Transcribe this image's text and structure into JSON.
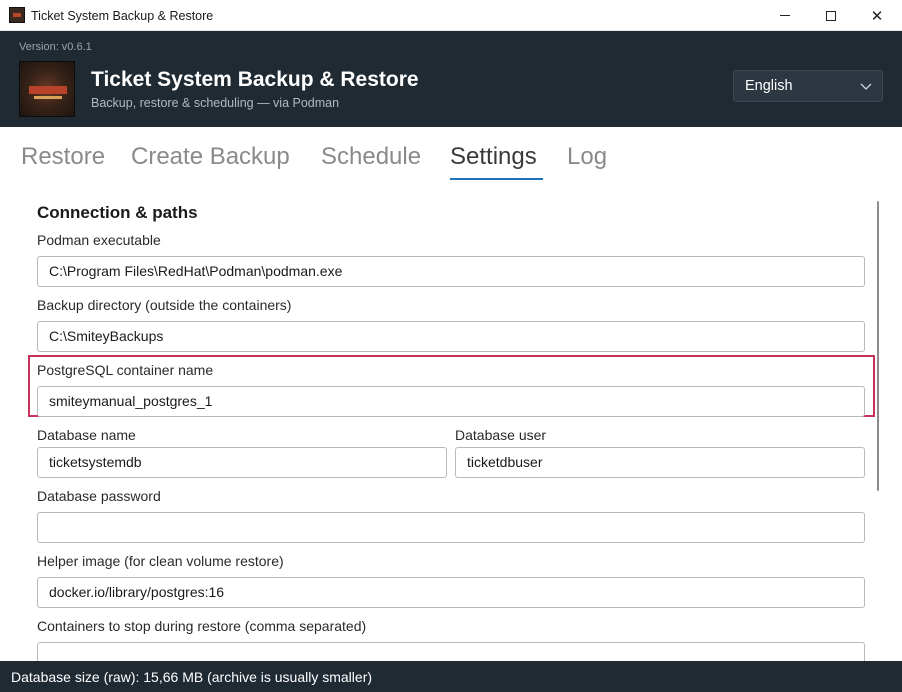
{
  "window": {
    "title": "Ticket System Backup & Restore",
    "minimize_glyph": "",
    "maximize_glyph": "",
    "close_glyph": "✕"
  },
  "header": {
    "version": "Version: v0.6.1",
    "title": "Ticket System Backup & Restore",
    "subtitle": "Backup, restore & scheduling — via Podman",
    "language": "English"
  },
  "tabs": [
    {
      "label": "Restore",
      "active": false
    },
    {
      "label": "Create Backup",
      "active": false
    },
    {
      "label": "Schedule",
      "active": false
    },
    {
      "label": "Settings",
      "active": true
    },
    {
      "label": "Log",
      "active": false
    }
  ],
  "settings": {
    "section_title": "Connection & paths",
    "podman_exe": {
      "label": "Podman executable",
      "value": "C:\\Program Files\\RedHat\\Podman\\podman.exe"
    },
    "backup_dir": {
      "label": "Backup directory (outside the containers)",
      "value": "C:\\SmiteyBackups"
    },
    "pg_container": {
      "label": "PostgreSQL container name",
      "value": "smiteymanual_postgres_1"
    },
    "db_name": {
      "label": "Database name",
      "value": "ticketsystemdb"
    },
    "db_user": {
      "label": "Database user",
      "value": "ticketdbuser"
    },
    "db_password": {
      "label": "Database password",
      "value": ""
    },
    "helper_image": {
      "label": "Helper image (for clean volume restore)",
      "value": "docker.io/library/postgres:16"
    },
    "containers_stop": {
      "label": "Containers to stop during restore (comma separated)",
      "value": ""
    }
  },
  "status": {
    "text": "Database size (raw): 15,66 MB (archive is usually smaller)"
  },
  "colors": {
    "header_bg": "#202a33",
    "accent": "#1e73b8",
    "highlight": "#c6325a"
  }
}
